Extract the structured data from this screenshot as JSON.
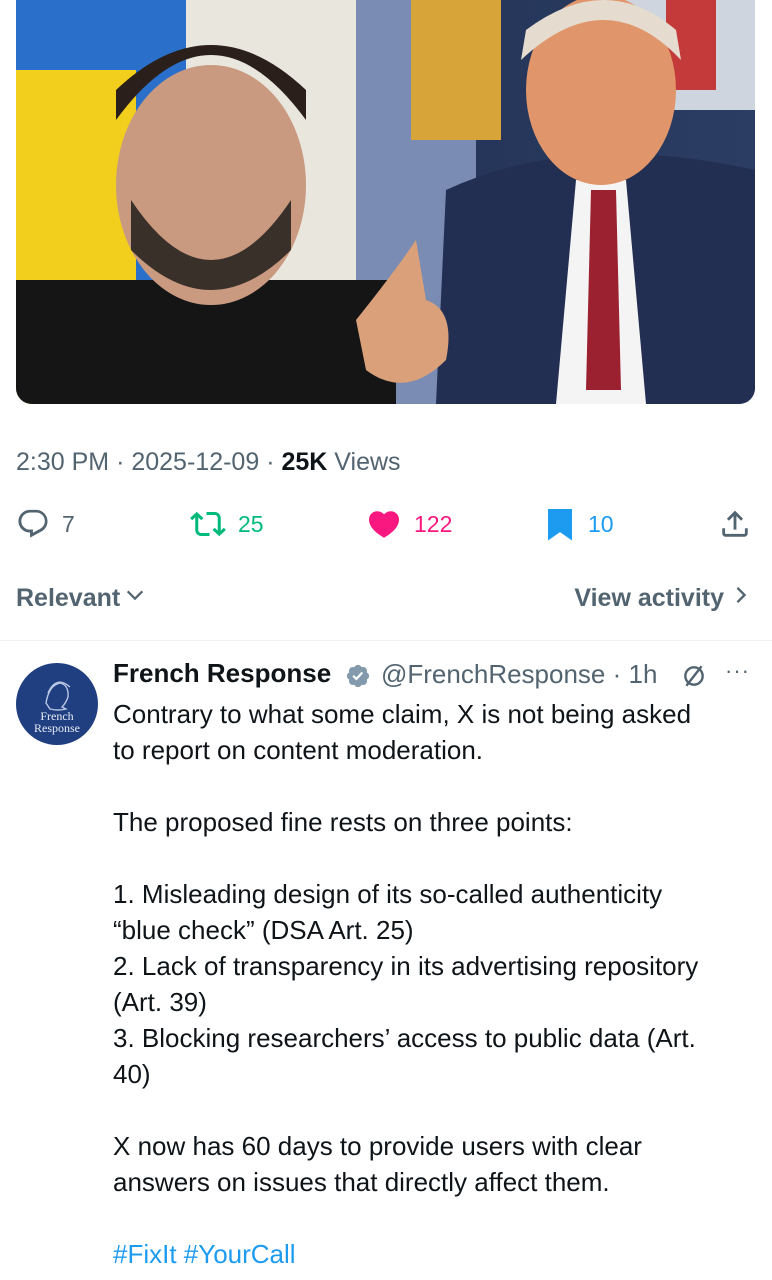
{
  "tweet": {
    "time": "2:30 PM",
    "date": "2025-12-09",
    "sep": "·",
    "views_count": "25K",
    "views_label": "Views"
  },
  "actions": {
    "replies": "7",
    "retweets": "25",
    "likes": "122",
    "bookmarks": "10"
  },
  "sortbar": {
    "sort_label": "Relevant",
    "activity_label": "View activity"
  },
  "reply": {
    "avatar_text_line1": "French",
    "avatar_text_line2": "Response",
    "name": "French Response",
    "handle": "@FrenchResponse",
    "age": "1h",
    "more": "···",
    "lines": [
      "Contrary to what some claim, X is not being asked",
      "to report on content moderation.",
      "",
      "The proposed fine rests on three points:",
      "",
      "1. Misleading design of its so-called authenticity",
      "“blue check” (DSA Art. 25)",
      "2. Lack of transparency in its advertising repository",
      "(Art. 39)",
      "3. Blocking researchers’ access to public data (Art.",
      "40)",
      "",
      "X now has 60 days to provide users with clear",
      "answers on issues that directly affect them.",
      ""
    ],
    "hashtags": "#FixIt #YourCall"
  },
  "colors": {
    "retweet_green": "#00ba7c",
    "like_pink": "#f91880",
    "bookmark_blue": "#1d9bf0",
    "secondary_text": "#536471"
  },
  "icons": [
    "reply-icon",
    "retweet-icon",
    "like-icon",
    "bookmark-icon",
    "share-icon",
    "chevron-down-icon",
    "chevron-right-icon",
    "verified-badge-icon",
    "grok-icon",
    "more-icon"
  ]
}
